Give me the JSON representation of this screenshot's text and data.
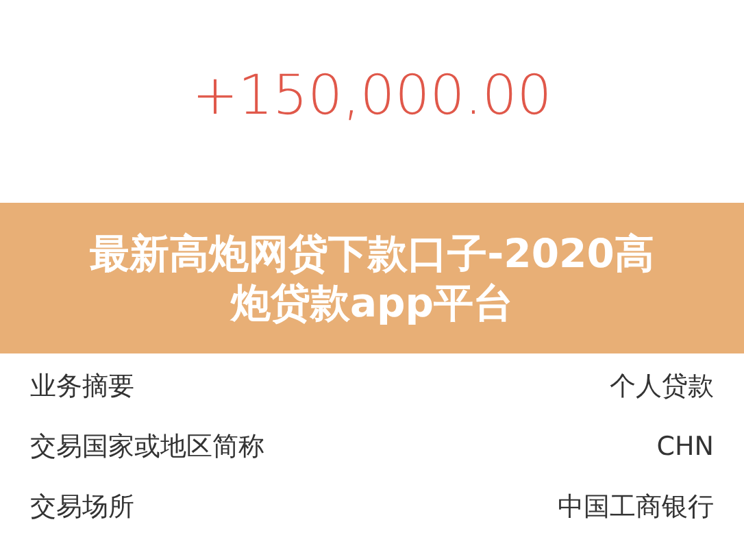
{
  "amount": "+150,000.00",
  "banner": {
    "title": "最新高炮网贷下款口子-2020高炮贷款app平台"
  },
  "details": [
    {
      "label": "业务摘要",
      "value": "个人贷款"
    },
    {
      "label": "交易国家或地区简称",
      "value": "CHN"
    },
    {
      "label": "交易场所",
      "value": "中国工商银行"
    }
  ]
}
